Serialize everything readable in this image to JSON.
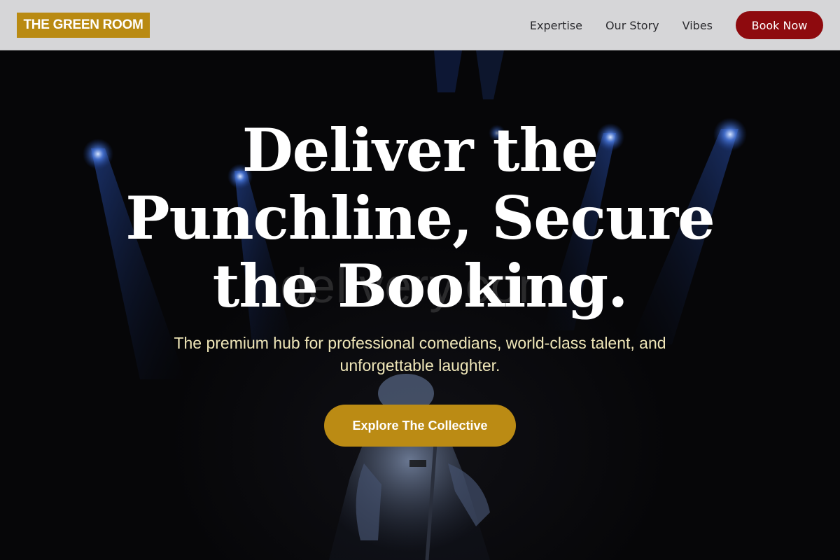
{
  "header": {
    "logo": "THE GREEN ROOM",
    "nav": [
      {
        "label": "Expertise"
      },
      {
        "label": "Our Story"
      },
      {
        "label": "Vibes"
      }
    ],
    "book_label": "Book Now"
  },
  "hero": {
    "title_lines": [
      "Deliver the",
      "Punchline, Secure",
      "the Booking."
    ],
    "subtitle": "The premium hub for professional comedians, world-class talent, and unforgettable laughter.",
    "cta_label": "Explore The Collective",
    "watermark": "delivery.com",
    "background_image": "comedian-on-stage-with-microphone-and-blue-stage-lights"
  },
  "colors": {
    "logo_bg": "#b98a12",
    "book_button": "#8e0a0e",
    "cta_button": "#bb8b14",
    "header_bg": "#d6d6d8",
    "subtitle_text": "#efe6b8"
  }
}
